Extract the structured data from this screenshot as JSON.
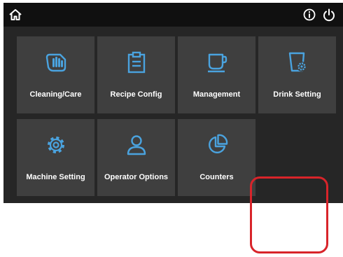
{
  "colors": {
    "accent": "#4aa3df",
    "tile_background": "#3f3f3f",
    "screen_background": "#262626",
    "topbar_background": "#101010",
    "highlight": "#d8242a"
  },
  "topbar": {
    "home_icon": "home-icon",
    "info_icon": "info-icon",
    "power_icon": "power-icon"
  },
  "menu": {
    "tiles": [
      {
        "label": "Cleaning/Care",
        "icon": "cleaning-hand-icon"
      },
      {
        "label": "Recipe Config",
        "icon": "clipboard-icon"
      },
      {
        "label": "Management",
        "icon": "cup-icon"
      },
      {
        "label": "Drink Setting",
        "icon": "cup-gear-icon"
      },
      {
        "label": "Machine Setting",
        "icon": "gear-icon"
      },
      {
        "label": "Operator Options",
        "icon": "user-icon"
      },
      {
        "label": "Counters",
        "icon": "pie-chart-icon"
      }
    ]
  }
}
